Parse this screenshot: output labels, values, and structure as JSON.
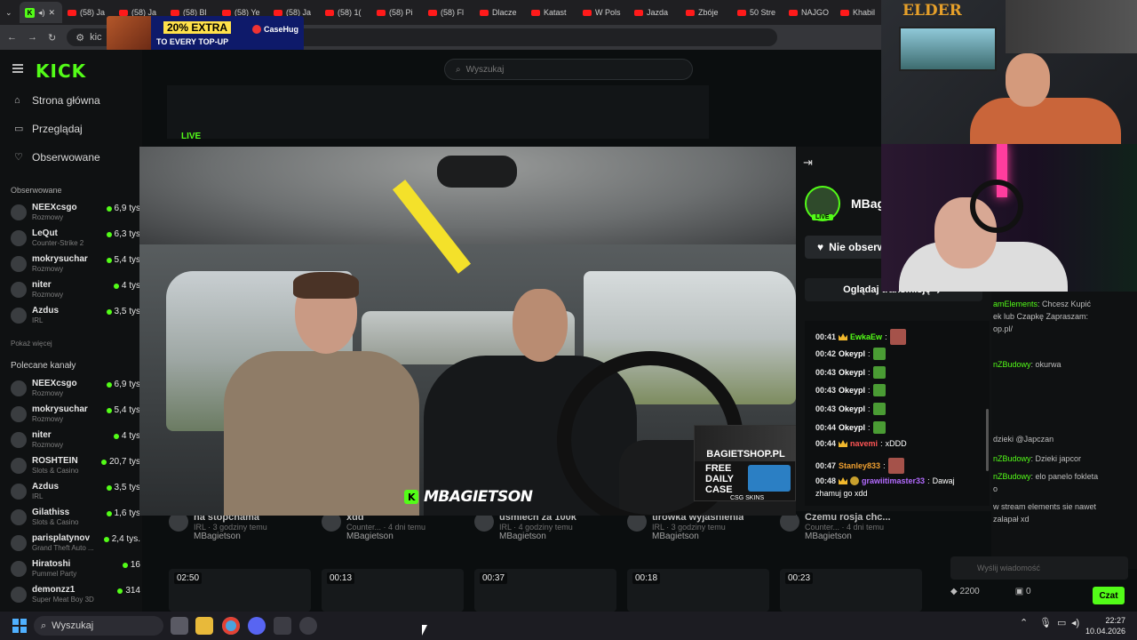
{
  "browser": {
    "tabs": [
      {
        "label": "(58) Ja"
      },
      {
        "label": "(58) Ja"
      },
      {
        "label": "(58) Bl"
      },
      {
        "label": "(58) Ye"
      },
      {
        "label": "(58) Ja"
      },
      {
        "label": "(58) 1("
      },
      {
        "label": "(58) Pi"
      },
      {
        "label": "(58) Fl"
      },
      {
        "label": "Dlacze"
      },
      {
        "label": "Katast"
      },
      {
        "label": "W Pols"
      },
      {
        "label": "Jazda"
      },
      {
        "label": "Zbóje"
      },
      {
        "label": "50 Stre"
      },
      {
        "label": "NAJGO"
      },
      {
        "label": "Khabil"
      }
    ],
    "url_fragment": "kic"
  },
  "ad": {
    "percent": "20% EXTRA",
    "line2": "TO EVERY TOP-UP",
    "brand": "CaseHug"
  },
  "kick": {
    "logo": "KICK",
    "search_placeholder": "Wyszukaj",
    "nav": {
      "home": "Strona główna",
      "browse": "Przeglądaj",
      "following": "Obserwowane"
    },
    "followed_label": "Obserwowane",
    "followed": [
      {
        "name": "NEEXcsgo",
        "category": "Rozmowy",
        "viewers": "6,9 tys"
      },
      {
        "name": "LeQut",
        "category": "Counter-Strike 2",
        "viewers": "6,3 tys"
      },
      {
        "name": "mokrysuchar",
        "category": "Rozmowy",
        "viewers": "5,4 tys"
      },
      {
        "name": "niter",
        "category": "Rozmowy",
        "viewers": "4 tys"
      },
      {
        "name": "Azdus",
        "category": "IRL",
        "viewers": "3,5 tys"
      }
    ],
    "show_more": "Pokaż więcej",
    "recommended_label": "Polecane kanały",
    "recommended": [
      {
        "name": "NEEXcsgo",
        "category": "Rozmowy",
        "viewers": "6,9 tys"
      },
      {
        "name": "mokrysuchar",
        "category": "Rozmowy",
        "viewers": "5,4 tys"
      },
      {
        "name": "niter",
        "category": "Rozmowy",
        "viewers": "4 tys"
      },
      {
        "name": "ROSHTEIN",
        "category": "Slots & Casino",
        "viewers": "20,7 tys"
      },
      {
        "name": "Azdus",
        "category": "IRL",
        "viewers": "3,5 tys"
      },
      {
        "name": "Gilathiss",
        "category": "Slots & Casino",
        "viewers": "1,6 tys"
      },
      {
        "name": "parisplatynov",
        "category": "Grand Theft Auto ...",
        "viewers": "2,4 tys."
      },
      {
        "name": "Hiratoshi",
        "category": "Pummel Party",
        "viewers": "16"
      },
      {
        "name": "demonzz1",
        "category": "Super Meat Boy 3D",
        "viewers": "314"
      }
    ],
    "live_label": "LIVE",
    "videos": [
      {
        "title": "na stopchama",
        "meta": "IRL · 3 godziny temu",
        "channel": "MBagietson"
      },
      {
        "title": "xdd",
        "meta": "Counter... · 4 dni temu",
        "channel": "MBagietson"
      },
      {
        "title": "usmiech za 100k",
        "meta": "IRL · 4 godziny temu",
        "channel": "MBagietson"
      },
      {
        "title": "tirowka wyjaśnienia",
        "meta": "IRL · 3 godziny temu",
        "channel": "MBagietson"
      },
      {
        "title": "Czemu rosja chc...",
        "meta": "Counter... · 4 dni temu",
        "channel": "MBagietson"
      }
    ],
    "durations": [
      "02:50",
      "00:13",
      "00:37",
      "00:18",
      "00:23"
    ]
  },
  "player": {
    "watermark": "MBAGIETSON",
    "ad_shop": "BAGIETSHOP.PL",
    "ad_case": "FREE DAILY CASE",
    "ad_site": "CSG SKINS"
  },
  "panel": {
    "streamer": "MBagi",
    "live": "LIVE",
    "unfollow": "Nie obserw",
    "watch": "Oglądaj transmisję"
  },
  "chat": [
    {
      "time": "00:41",
      "user": "EwkaEw",
      "color": "#53fc18",
      "text": ""
    },
    {
      "time": "00:42",
      "user": "Okeypl",
      "color": "#ffffff",
      "text": ""
    },
    {
      "time": "00:43",
      "user": "Okeypl",
      "color": "#ffffff",
      "text": ""
    },
    {
      "time": "00:43",
      "user": "Okeypl",
      "color": "#ffffff",
      "text": ""
    },
    {
      "time": "00:43",
      "user": "Okeypl",
      "color": "#ffffff",
      "text": ""
    },
    {
      "time": "00:44",
      "user": "Okeypl",
      "color": "#ffffff",
      "text": ""
    },
    {
      "time": "00:44",
      "user": "navemi",
      "color": "#ff5555",
      "text": "xDDD"
    },
    {
      "time": "00:47",
      "user": "Stanley833",
      "color": "#f0a030",
      "text": ""
    },
    {
      "time": "00:48",
      "user": "grawiitimaster33",
      "color": "#b36bff",
      "text": "Dawaj"
    },
    {
      "time": "",
      "user": "",
      "color": "#ffffff",
      "text": "zhamuj go xdd"
    }
  ],
  "right_chat": [
    {
      "user": "amElements",
      "text": ": Chcesz Kupić"
    },
    {
      "user": "",
      "text": "ek lub Czapkę Zapraszam:"
    },
    {
      "user": "",
      "text": "op.pl/"
    },
    {
      "user": "nZBudowy",
      "text": ": okurwa"
    },
    {
      "user": "",
      "text": "dzieki @Japczan"
    },
    {
      "user": "nZBudowy",
      "text": ": Dzieki japcor"
    },
    {
      "user": "nZBudowy",
      "text": ": elo panelo fokleta"
    },
    {
      "user": "",
      "text": "o"
    },
    {
      "user": "",
      "text": "w stream elements sie nawet"
    },
    {
      "user": "",
      "text": "zalapał xd"
    }
  ],
  "chat_input_placeholder": "Wyślij wiadomość",
  "chat_points": "2200",
  "chat_count": "0",
  "chat_button": "Czat",
  "cam_overlay": "ELDER",
  "taskbar": {
    "search": "Wyszukaj",
    "time": "22:27",
    "date": "10.04.2026"
  }
}
